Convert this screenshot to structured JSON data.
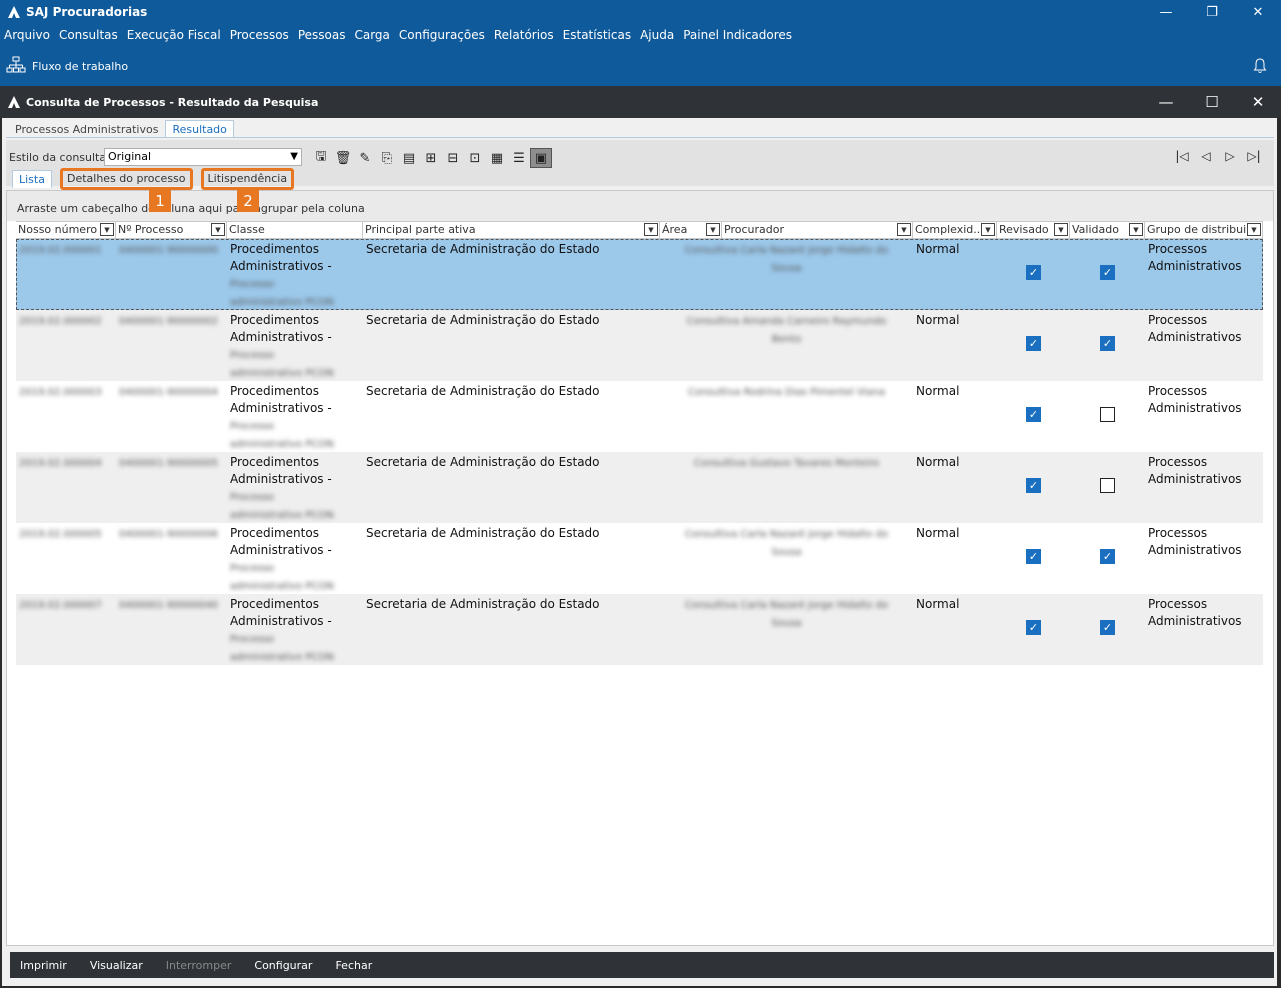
{
  "app": {
    "title": "SAJ Procuradorias",
    "menu": [
      "Arquivo",
      "Consultas",
      "Execução Fiscal",
      "Processos",
      "Pessoas",
      "Carga",
      "Configurações",
      "Relatórios",
      "Estatísticas",
      "Ajuda",
      "Painel Indicadores"
    ],
    "workflow_label": "Fluxo de trabalho",
    "window_controls": [
      "—",
      "❐",
      "✕"
    ]
  },
  "child": {
    "title": "Consulta de Processos - Resultado da Pesquisa",
    "window_controls": [
      "—",
      "☐",
      "✕"
    ],
    "tabs": [
      "Processos Administrativos",
      "Resultado"
    ],
    "estilo_label": "Estilo da consulta",
    "estilo_value": "Original",
    "sub_tabs": [
      "Lista",
      "Detalhes do processo",
      "Litispendência"
    ],
    "callouts": [
      "1",
      "2"
    ],
    "group_hint": "Arraste um cabeçalho de coluna aqui para agrupar pela coluna",
    "columns": [
      "Nosso número",
      "Nº Processo",
      "Classe",
      "Principal parte ativa",
      "Área",
      "Procurador",
      "Complexid...",
      "Revisado",
      "Validado",
      "Grupo de distribui..."
    ],
    "rows": [
      {
        "nosso": "2019.02.000001",
        "processo": "0400001-90000000",
        "classe1": "Procedimentos",
        "classe2": "Administrativos -",
        "classe3": "Processo",
        "classe4": "administrativo PCON",
        "parte": "Secretaria de Administração do Estado",
        "procurador1": "Consultiva Carla Nazaré Jorge Hidalto do",
        "procurador2": "Sousa",
        "complexidade": "Normal",
        "revisado": true,
        "validado": true,
        "grupo1": "Processos",
        "grupo2": "Administrativos"
      },
      {
        "nosso": "2019.02.000002",
        "processo": "0400001-90000002",
        "classe1": "Procedimentos",
        "classe2": "Administrativos -",
        "classe3": "Processo",
        "classe4": "administrativo PCON",
        "parte": "Secretaria de Administração do Estado",
        "procurador1": "Consultiva Amanda Carneiro Raymundo",
        "procurador2": "Bento",
        "complexidade": "Normal",
        "revisado": true,
        "validado": true,
        "grupo1": "Processos",
        "grupo2": "Administrativos"
      },
      {
        "nosso": "2019.02.000003",
        "processo": "0400001-90000004",
        "classe1": "Procedimentos",
        "classe2": "Administrativos -",
        "classe3": "Processo",
        "classe4": "administrativo PCON",
        "parte": "Secretaria de Administração do Estado",
        "procurador1": "Consultiva Rodrina Dias Pimentel Viana",
        "procurador2": "",
        "complexidade": "Normal",
        "revisado": true,
        "validado": false,
        "grupo1": "Processos",
        "grupo2": "Administrativos"
      },
      {
        "nosso": "2019.02.000004",
        "processo": "0400001-90000005",
        "classe1": "Procedimentos",
        "classe2": "Administrativos -",
        "classe3": "Processo",
        "classe4": "administrativo PCON",
        "parte": "Secretaria de Administração do Estado",
        "procurador1": "Consultiva Gustavo Tavares Monteiro",
        "procurador2": "",
        "complexidade": "Normal",
        "revisado": true,
        "validado": false,
        "grupo1": "Processos",
        "grupo2": "Administrativos"
      },
      {
        "nosso": "2019.02.000005",
        "processo": "0400001-90000006",
        "classe1": "Procedimentos",
        "classe2": "Administrativos -",
        "classe3": "Processo",
        "classe4": "administrativo PCON",
        "parte": "Secretaria de Administração do Estado",
        "procurador1": "Consultiva Carla Nazaré Jorge Hidalto do",
        "procurador2": "Sousa",
        "complexidade": "Normal",
        "revisado": true,
        "validado": true,
        "grupo1": "Processos",
        "grupo2": "Administrativos"
      },
      {
        "nosso": "2019.02.000007",
        "processo": "0400001-90000040",
        "classe1": "Procedimentos",
        "classe2": "Administrativos -",
        "classe3": "Processo",
        "classe4": "administrativo PCON",
        "parte": "Secretaria de Administração do Estado",
        "procurador1": "Consultiva Carla Nazaré Jorge Hidalto do",
        "procurador2": "Sousa",
        "complexidade": "Normal",
        "revisado": true,
        "validado": true,
        "grupo1": "Processos",
        "grupo2": "Administrativos"
      }
    ],
    "bottom_buttons": [
      "Imprimir",
      "Visualizar",
      "Interromper",
      "Configurar",
      "Fechar"
    ]
  },
  "colors": {
    "accent_blue": "#0f5a9b",
    "highlight_orange": "#e87722",
    "selected_row": "#9cc8ea",
    "checkbox_blue": "#1a6fc0"
  },
  "icons": [
    "logo-icon",
    "workflow-icon",
    "bell-icon",
    "save-icon",
    "delete-icon",
    "edit-icon",
    "export-icon",
    "document-icon",
    "tree-icon",
    "columns-icon",
    "grid-icon",
    "list-icon",
    "view-icon",
    "first-page-icon",
    "prev-page-icon",
    "next-page-icon",
    "last-page-icon"
  ]
}
